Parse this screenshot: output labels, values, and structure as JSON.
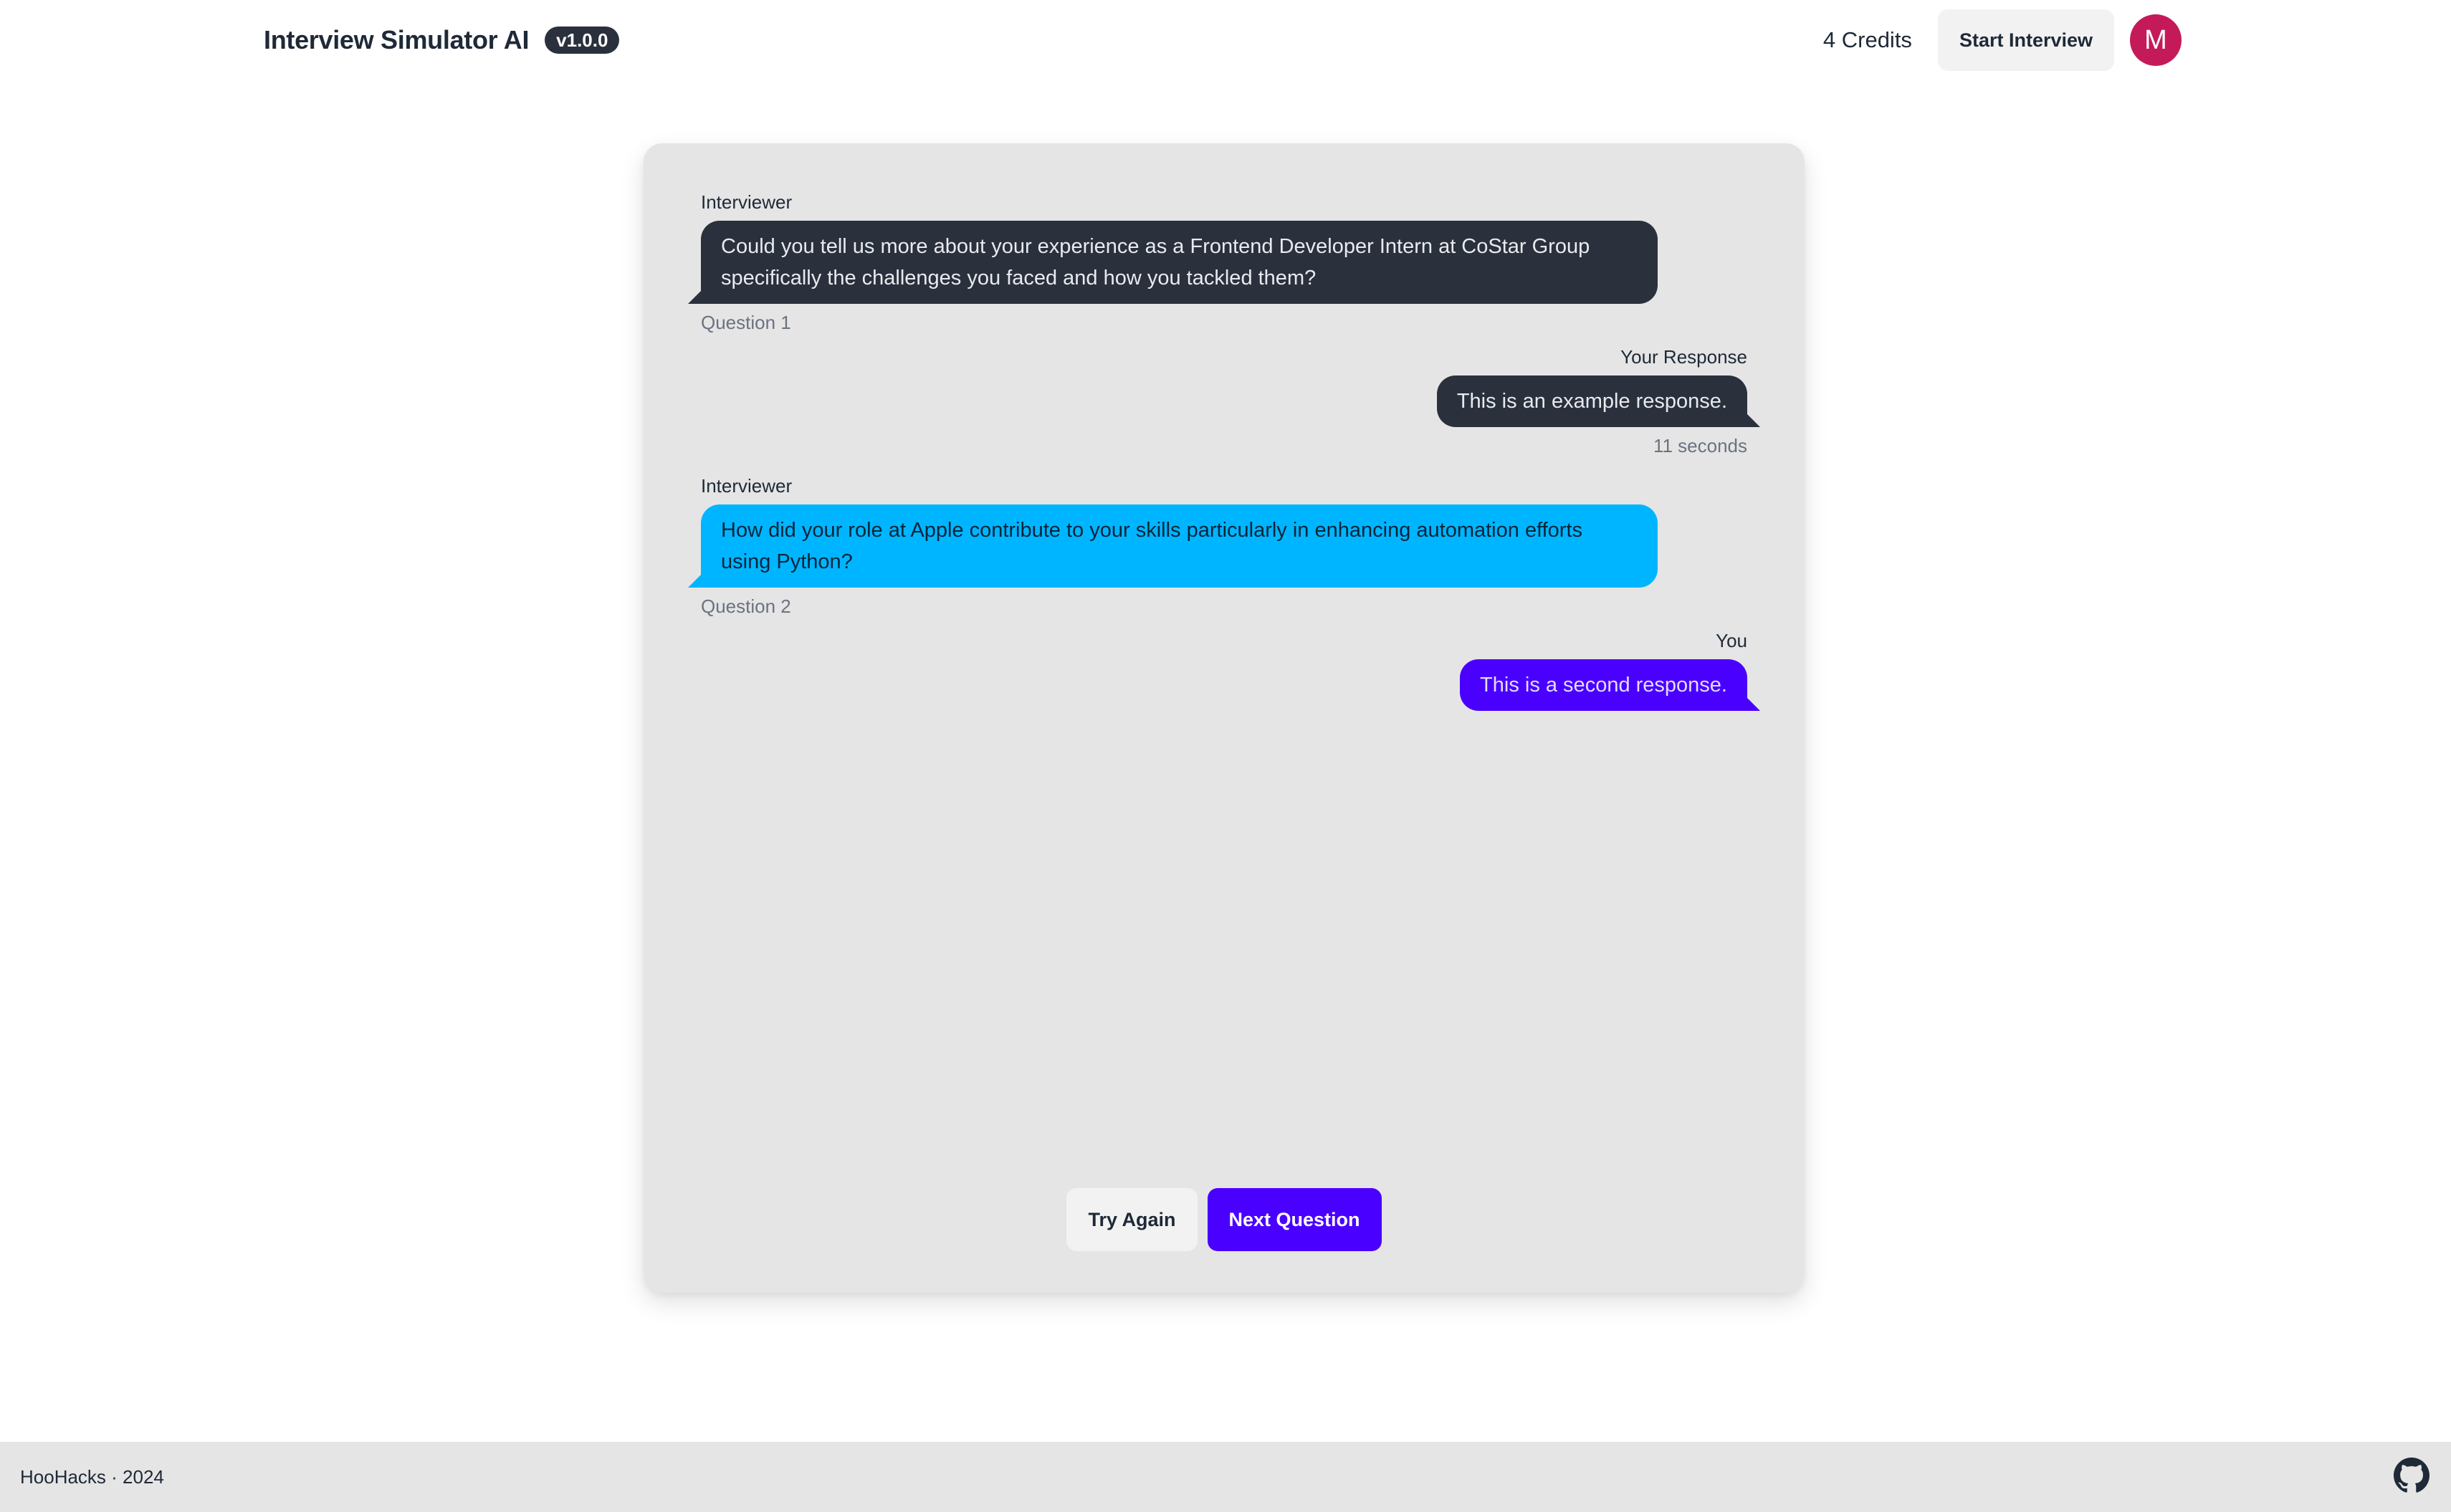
{
  "header": {
    "app_title": "Interview Simulator AI",
    "version": "v1.0.0",
    "credits": "4 Credits",
    "start_interview_label": "Start Interview",
    "avatar_initial": "M",
    "avatar_color": "#c41a5a"
  },
  "chat": {
    "messages": [
      {
        "side": "left",
        "header": "Interviewer",
        "text": "Could you tell us more about your experience as a Frontend Developer Intern at CoStar Group specifically the challenges you faced and how you tackled them?",
        "footer": "Question 1",
        "color": "#2a303c"
      },
      {
        "side": "right",
        "header": "Your Response",
        "text": "This is an example response.",
        "footer": "11 seconds",
        "color": "#2a303c"
      },
      {
        "side": "left",
        "header": "Interviewer",
        "text": "How did your role at Apple contribute to your skills particularly in enhancing automation efforts using Python?",
        "footer": "Question 2",
        "color": "#00b5ff"
      },
      {
        "side": "right",
        "header": "You",
        "text": "This is a second response.",
        "footer": "",
        "color": "#4a00ff"
      }
    ]
  },
  "actions": {
    "try_again_label": "Try Again",
    "next_question_label": "Next Question"
  },
  "footer": {
    "text": "HooHacks · 2024",
    "icon": "github-icon"
  },
  "colors": {
    "primary": "#4a00ff",
    "info": "#00b5ff",
    "neutral": "#2a303c",
    "card_background": "#e5e5e5"
  }
}
